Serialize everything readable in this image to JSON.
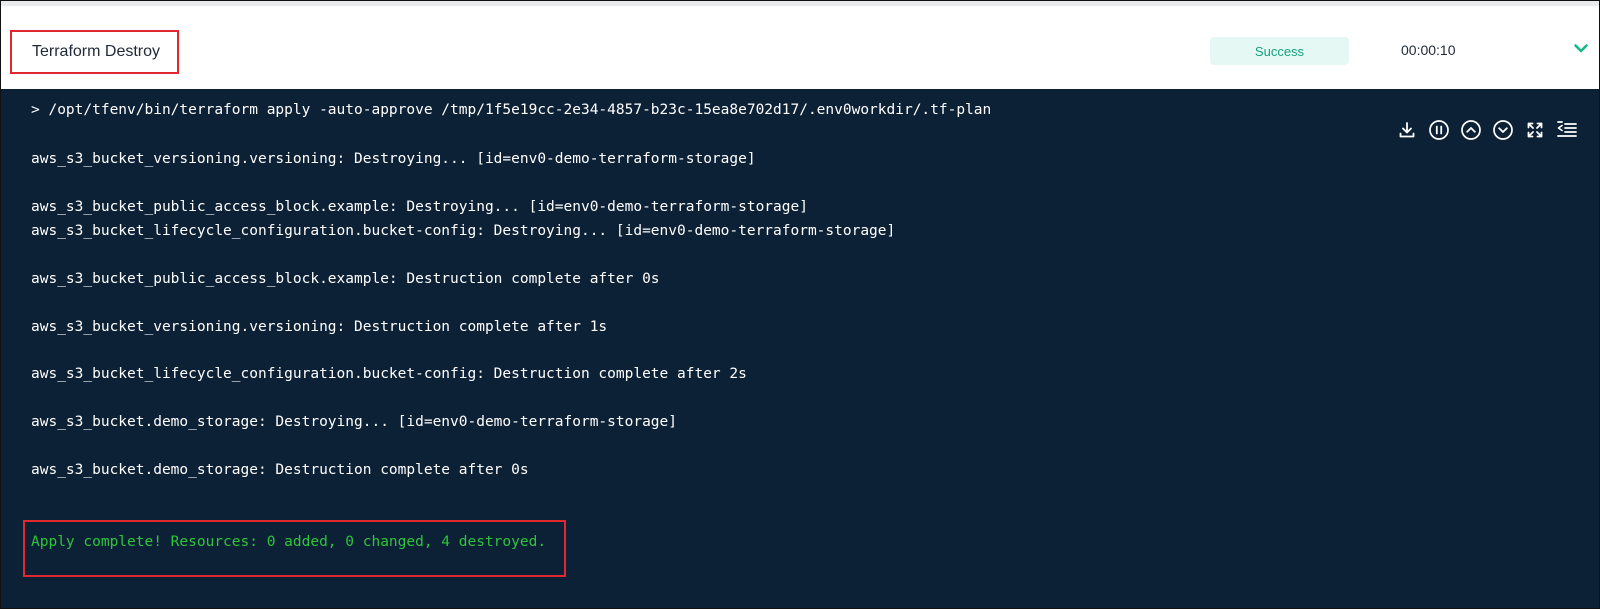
{
  "step": {
    "title": "Terraform Destroy",
    "status": "Success",
    "duration": "00:00:10"
  },
  "colors": {
    "terminal_bg": "#0d2136",
    "status_text": "#14a37f",
    "status_bg": "#e5f8f3",
    "success_text": "#2ec43b",
    "highlight": "#e0282e"
  },
  "toolbar": [
    {
      "name": "download-icon"
    },
    {
      "name": "pause-icon"
    },
    {
      "name": "scroll-up-icon"
    },
    {
      "name": "scroll-down-icon"
    },
    {
      "name": "fullscreen-icon"
    },
    {
      "name": "collapse-list-icon"
    }
  ],
  "log": {
    "command": "> /opt/tfenv/bin/terraform apply -auto-approve /tmp/1f5e19cc-2e34-4857-b23c-15ea8e702d17/.env0workdir/.tf-plan",
    "lines": [
      "aws_s3_bucket_versioning.versioning: Destroying... [id=env0-demo-terraform-storage]",
      "aws_s3_bucket_public_access_block.example: Destroying... [id=env0-demo-terraform-storage]",
      "aws_s3_bucket_lifecycle_configuration.bucket-config: Destroying... [id=env0-demo-terraform-storage]",
      "aws_s3_bucket_public_access_block.example: Destruction complete after 0s",
      "aws_s3_bucket_versioning.versioning: Destruction complete after 1s",
      "aws_s3_bucket_lifecycle_configuration.bucket-config: Destruction complete after 2s",
      "aws_s3_bucket.demo_storage: Destroying... [id=env0-demo-terraform-storage]",
      "aws_s3_bucket.demo_storage: Destruction complete after 0s"
    ],
    "result": "Apply complete! Resources: 0 added, 0 changed, 4 destroyed."
  }
}
